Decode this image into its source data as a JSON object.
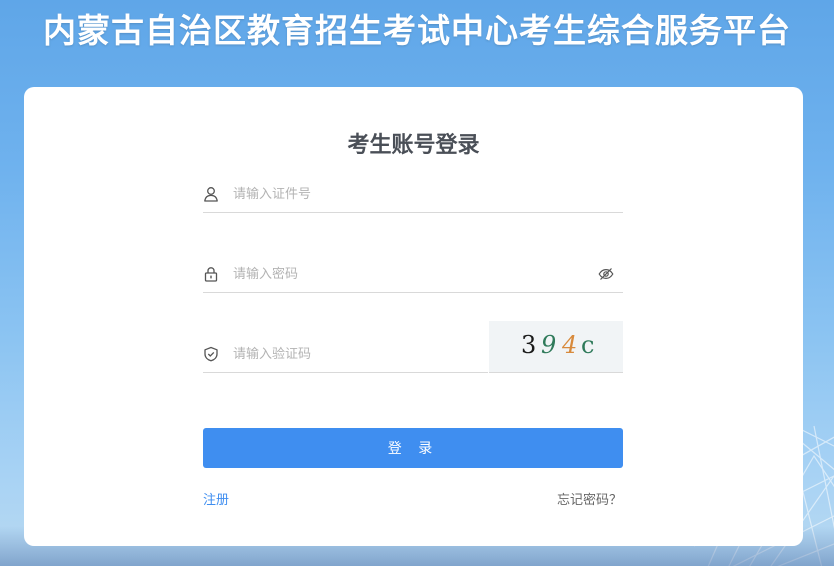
{
  "site": {
    "title": "内蒙古自治区教育招生考试中心考生综合服务平台"
  },
  "login": {
    "heading": "考生账号登录",
    "id_field": {
      "placeholder": "请输入证件号",
      "value": "",
      "icon": "user-icon"
    },
    "password_field": {
      "placeholder": "请输入密码",
      "value": "",
      "icon": "lock-icon",
      "toggle_icon": "eye-off-icon"
    },
    "captcha_field": {
      "placeholder": "请输入验证码",
      "value": "",
      "icon": "shield-check-icon"
    },
    "captcha_image": {
      "chars": [
        "3",
        "9",
        "4",
        "c"
      ],
      "colors": [
        "#1a1a1a",
        "#2f7a5a",
        "#d88a3c",
        "#2f7a5a"
      ]
    },
    "submit_label": "登 录",
    "register_link": "注册",
    "forgot_link": "忘记密码？"
  },
  "colors": {
    "primary": "#3f8ef0",
    "title_text": "#ffffff",
    "heading_text": "#4a4f57"
  }
}
